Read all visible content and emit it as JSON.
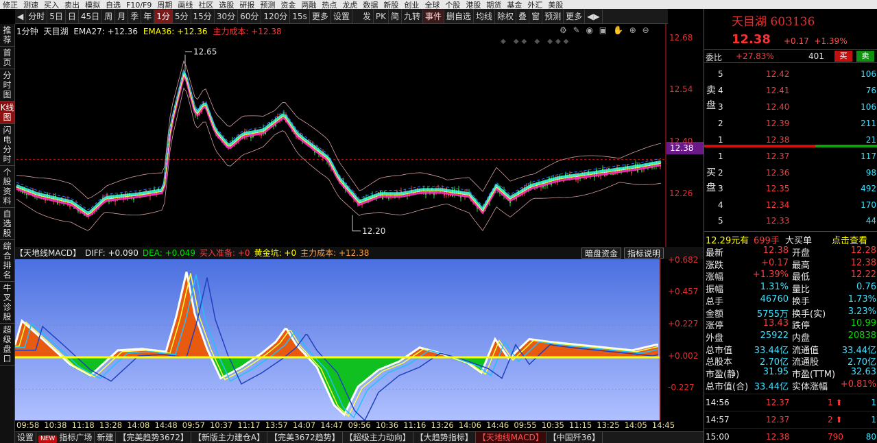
{
  "topmenu": [
    "修正",
    "测速",
    "买入",
    "卖出",
    "模拟",
    "自选",
    "F10/F9",
    "周期",
    "画线",
    "社区",
    "选股",
    "研报",
    "预测",
    "资金",
    "两融",
    "热点",
    "龙虎",
    "数据",
    "新股",
    "创业",
    "全球",
    "个股",
    "港股",
    "期货",
    "基金",
    "外汇",
    "美股"
  ],
  "toolbar": {
    "periods": [
      "分时",
      "5日",
      "日",
      "45日",
      "周",
      "月",
      "季",
      "年",
      "1分",
      "5分",
      "15分",
      "30分",
      "60分",
      "120分",
      "15s",
      "更多",
      "设置"
    ],
    "active_period": "1分",
    "tools": [
      "发",
      "PK",
      "简",
      "九转",
      "事件",
      "删自选",
      "均线",
      "除权",
      "叠",
      "窗",
      "预测",
      "更多"
    ]
  },
  "sidebar": [
    "推荐",
    "首页",
    "分时图",
    "K线图",
    "闪电分时",
    "个股资料",
    "自选股",
    "综合排名",
    "牛叉诊股",
    "超级盘口"
  ],
  "sidebar_active": "K线图",
  "kline": {
    "period_label": "1分钟",
    "stock_name": "天目湖",
    "ema27_label": "EMA27: +12.36",
    "ema36_label": "EMA36: +12.36",
    "cost_label": "主力成本: +12.38",
    "annot_high": "12.65",
    "annot_low": "12.20",
    "current_price_box": "12.38",
    "y_labels": [
      "12.68",
      "12.54",
      "12.40",
      "12.26"
    ],
    "icons": [
      "gear-icon",
      "pen-icon",
      "eye-icon",
      "briefcase-icon",
      "hand-icon",
      "zoom-in-icon",
      "zoom-out-icon"
    ]
  },
  "macd": {
    "title": "【天地线MACD】",
    "diff": "DIFF: +0.090",
    "dea": "DEA: +0.049",
    "buy_prep": "买入准备: +0",
    "gold_pit": "黄金坑: +0",
    "cost": "主力成本: +12.38",
    "btn1": "暗盘资金",
    "btn2": "指标说明",
    "y_labels": [
      "+0.682",
      "+0.457",
      "+0.227",
      "+0.002",
      "-0.227"
    ]
  },
  "x_labels": [
    "09:58",
    "10:38",
    "11:18",
    "13:28",
    "14:08",
    "14:48",
    "09:57",
    "10:37",
    "11:17",
    "13:57",
    "14:07",
    "14:47",
    "09:56",
    "10:36",
    "11:16",
    "13:26",
    "14:06",
    "14:46",
    "09:55",
    "10:35",
    "11:15",
    "13:25",
    "14:05",
    "14:45"
  ],
  "bottombar": {
    "items": [
      "设置",
      "指标广场",
      "新建",
      "【完美趋势3672】",
      "【新版主力建仓A】",
      "【完美3672趋势】",
      "【超级主力动向】",
      "【大趋势指标】",
      "【天地线MACD】",
      "【中国歼36】"
    ],
    "new_tag": "NEW",
    "active": "【天地线MACD】"
  },
  "quote": {
    "name": "天目湖 603136",
    "price": "12.38",
    "change": "+0.17",
    "pct": "+1.39%",
    "wb_label": "委比",
    "wb_value": "+27.83%",
    "wb_diff": "401",
    "buy_btn": "买",
    "sell_btn": "卖",
    "sell_label": "卖盘",
    "buy_label": "买盘",
    "asks": [
      {
        "lv": "5",
        "price": "12.42",
        "vol": "106"
      },
      {
        "lv": "4",
        "price": "12.41",
        "vol": "76"
      },
      {
        "lv": "3",
        "price": "12.40",
        "vol": "106"
      },
      {
        "lv": "2",
        "price": "12.39",
        "vol": "211"
      },
      {
        "lv": "1",
        "price": "12.38",
        "vol": "21"
      }
    ],
    "bids": [
      {
        "lv": "1",
        "price": "12.37",
        "vol": "117"
      },
      {
        "lv": "2",
        "price": "12.36",
        "vol": "98"
      },
      {
        "lv": "3",
        "price": "12.35",
        "vol": "492"
      },
      {
        "lv": "4",
        "price": "12.34",
        "vol": "170"
      },
      {
        "lv": "5",
        "price": "12.33",
        "vol": "44"
      }
    ],
    "big_order": "12.29元有",
    "big_order_vol": "699手",
    "big_order_side": "大买单",
    "big_order_link": "点击查看",
    "stats": [
      [
        "最新",
        "12.38",
        "开盘",
        "12.28"
      ],
      [
        "涨跌",
        "+0.17",
        "最高",
        "12.38"
      ],
      [
        "涨幅",
        "+1.39%",
        "最低",
        "12.22"
      ],
      [
        "振幅",
        "1.31%",
        "量比",
        "0.76"
      ],
      [
        "总手",
        "46760",
        "换手",
        "1.73%"
      ],
      [
        "金额",
        "5755万",
        "换手(实)",
        "3.23%"
      ],
      [
        "涨停",
        "13.43",
        "跌停",
        "10.99"
      ],
      [
        "外盘",
        "25922",
        "内盘",
        "20838"
      ],
      [
        "总市值",
        "33.44亿",
        "流通值",
        "33.44亿"
      ],
      [
        "总股本",
        "2.70亿",
        "流通股",
        "2.70亿"
      ],
      [
        "市盈(静)",
        "31.95",
        "市盈(TTM)",
        "32.63"
      ],
      [
        "总市值(合)",
        "33.44亿",
        "实体涨幅",
        "+0.81%"
      ]
    ],
    "ticks": [
      {
        "t": "14:56",
        "p": "12.37",
        "v": "1",
        "n": "1"
      },
      {
        "t": "14:57",
        "p": "12.37",
        "v": "2",
        "n": "1"
      },
      {
        "t": "15:00",
        "p": "12.38",
        "v": "790",
        "n": "80"
      }
    ]
  },
  "colors": {
    "up": "#ff3b3b",
    "down": "#00e000",
    "accent": "#6a1a88"
  }
}
